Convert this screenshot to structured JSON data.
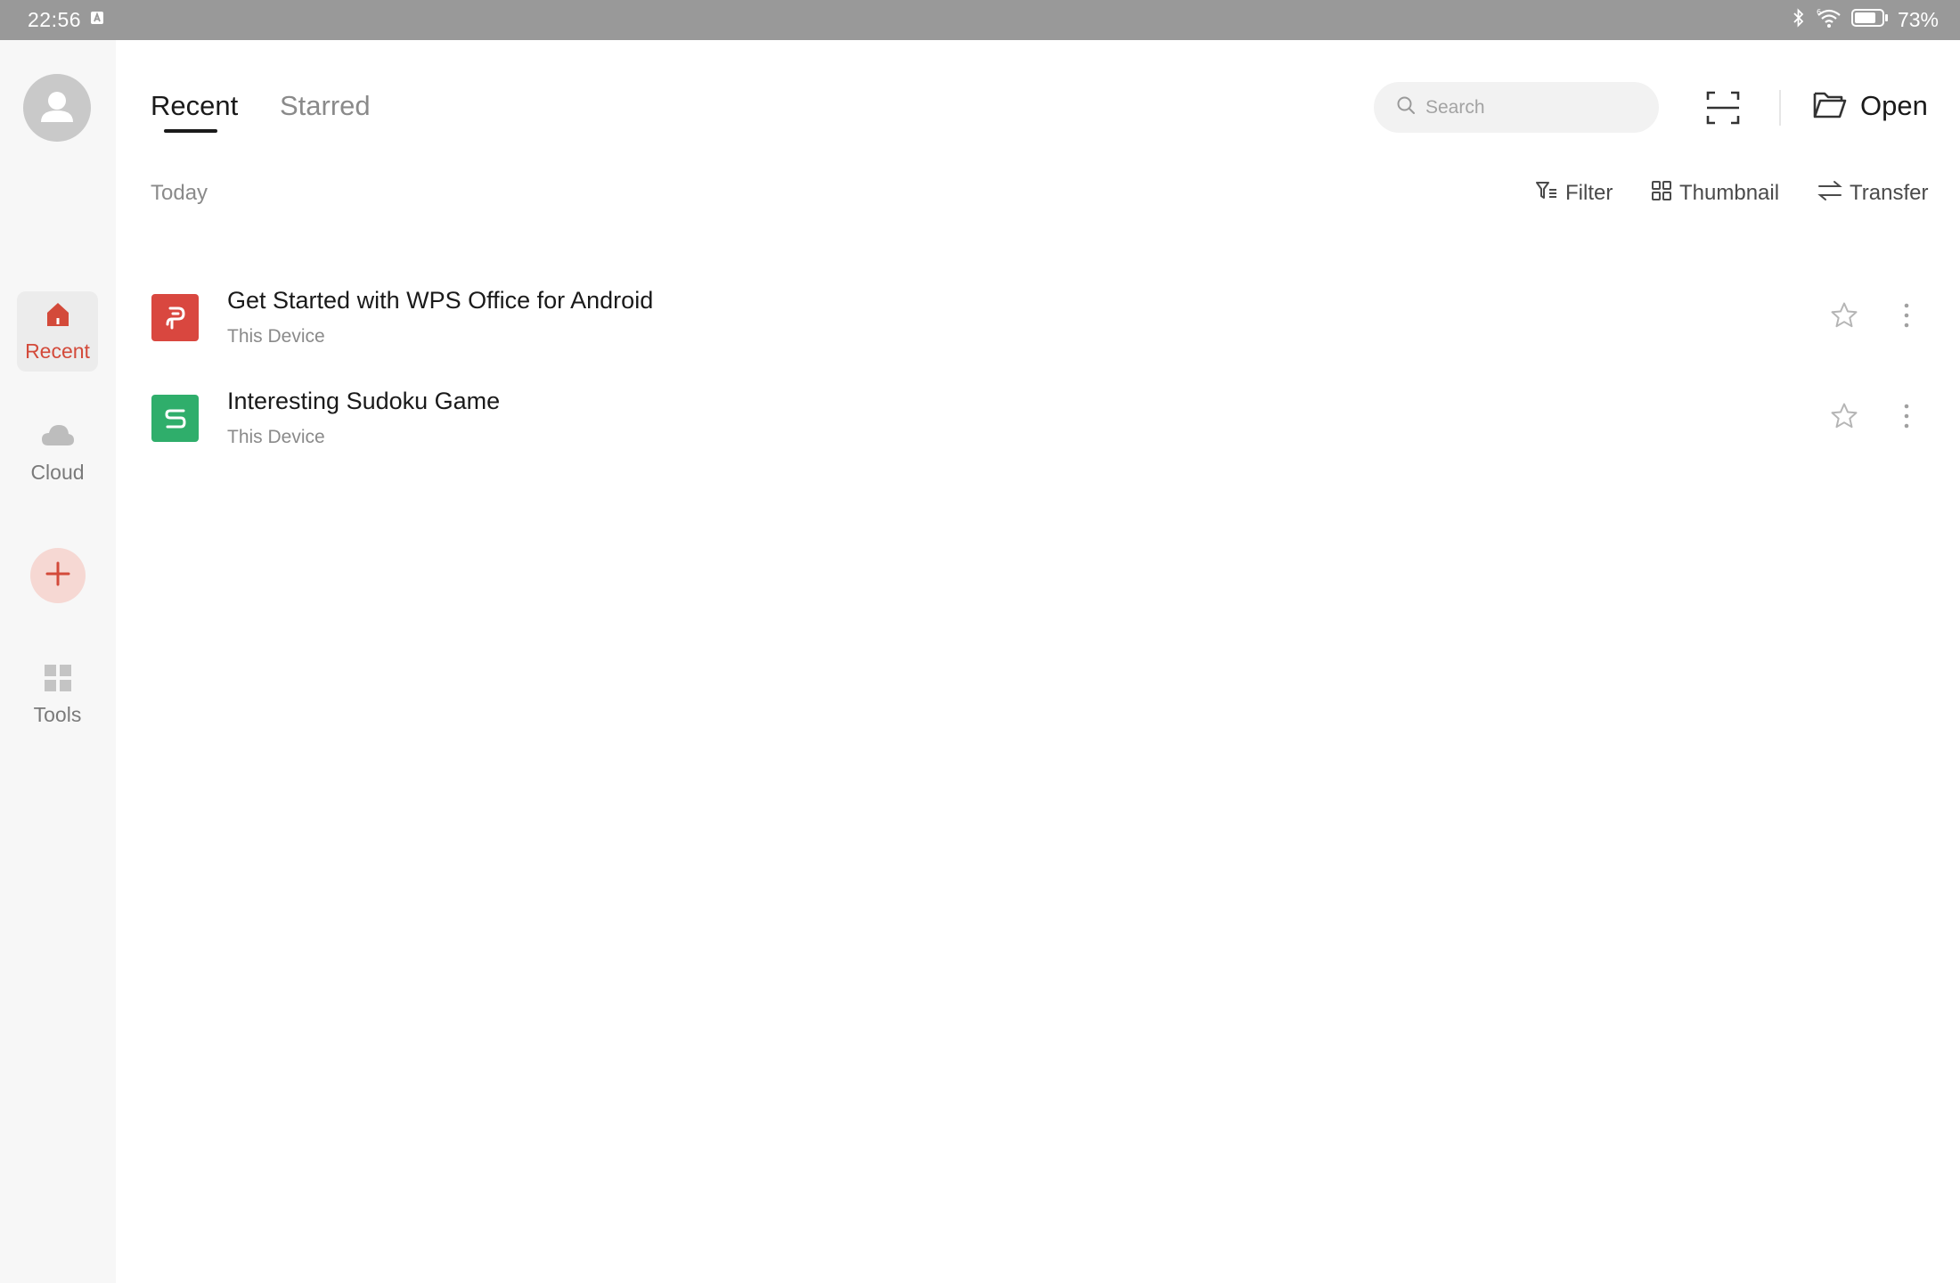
{
  "status_bar": {
    "time": "22:56",
    "battery_percent": "73%",
    "icons": [
      "notification-a-icon",
      "bluetooth-icon",
      "wifi-6-icon",
      "battery-icon"
    ]
  },
  "sidebar": {
    "avatar_icon": "user-avatar-icon",
    "items": [
      {
        "label": "Recent",
        "icon": "home-icon",
        "active": true
      },
      {
        "label": "Cloud",
        "icon": "cloud-icon",
        "active": false
      },
      {
        "label": "Tools",
        "icon": "grid-icon",
        "active": false
      }
    ],
    "add_icon": "plus-icon"
  },
  "header": {
    "tabs": [
      {
        "label": "Recent",
        "active": true
      },
      {
        "label": "Starred",
        "active": false
      }
    ],
    "search": {
      "placeholder": "Search"
    },
    "scan_icon": "scan-icon",
    "open_label": "Open"
  },
  "section": {
    "title": "Today"
  },
  "toolbar": {
    "filter_label": "Filter",
    "thumbnail_label": "Thumbnail",
    "transfer_label": "Transfer"
  },
  "files": [
    {
      "name": "Get Started with WPS Office for Android",
      "location": "This Device",
      "type": "presentation",
      "color": "#d9473f"
    },
    {
      "name": "Interesting Sudoku Game",
      "location": "This Device",
      "type": "spreadsheet",
      "color": "#2fae6b"
    }
  ],
  "colors": {
    "accent": "#d34a3a",
    "status_bar": "#999999",
    "sidebar_bg": "#f7f7f7"
  }
}
